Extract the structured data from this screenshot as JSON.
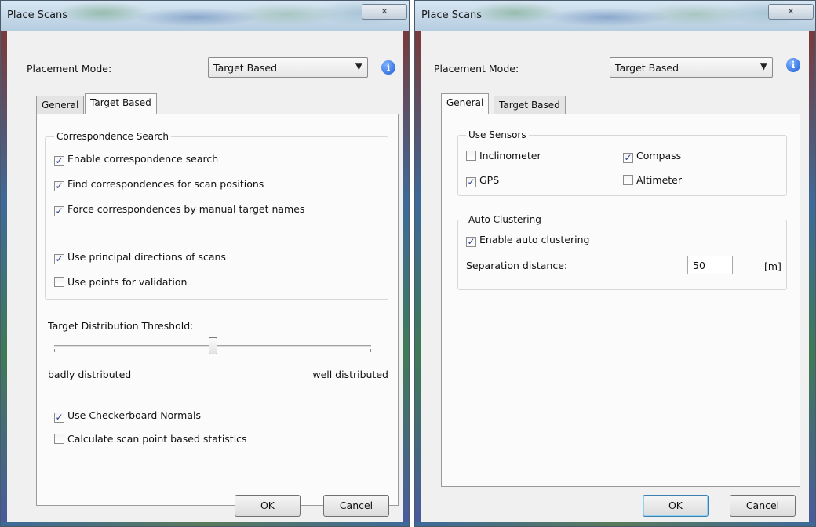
{
  "left": {
    "title": "Place Scans",
    "close_glyph": "✕",
    "placement_label": "Placement Mode:",
    "placement_value": "Target Based",
    "tabs": [
      {
        "label": "General"
      },
      {
        "label": "Target Based"
      }
    ],
    "active_tab": "Target Based",
    "corr_group": "Correspondence Search",
    "checks": [
      {
        "label": "Enable correspondence search",
        "checked": true
      },
      {
        "label": "Find correspondences for scan positions",
        "checked": true
      },
      {
        "label": "Force correspondences by manual target names",
        "checked": true
      },
      {
        "label": "Use principal directions of scans",
        "checked": true
      },
      {
        "label": "Use points for validation",
        "checked": false
      }
    ],
    "threshold_label": "Target Distribution Threshold:",
    "slider_value": 0.5,
    "slider_min_label": "badly distributed",
    "slider_max_label": "well distributed",
    "bottom_checks": [
      {
        "label": "Use Checkerboard Normals",
        "checked": true
      },
      {
        "label": "Calculate scan point based statistics",
        "checked": false
      }
    ],
    "ok": "OK",
    "cancel": "Cancel"
  },
  "right": {
    "title": "Place Scans",
    "close_glyph": "✕",
    "placement_label": "Placement Mode:",
    "placement_value": "Target Based",
    "tabs": [
      {
        "label": "General"
      },
      {
        "label": "Target Based"
      }
    ],
    "active_tab": "General",
    "sensors_group": "Use Sensors",
    "sensors": [
      {
        "label": "Inclinometer",
        "checked": false
      },
      {
        "label": "Compass",
        "checked": true
      },
      {
        "label": "GPS",
        "checked": true
      },
      {
        "label": "Altimeter",
        "checked": false
      }
    ],
    "cluster_group": "Auto Clustering",
    "cluster_enable": {
      "label": "Enable auto clustering",
      "checked": true
    },
    "separation_label": "Separation distance:",
    "separation_value": "50",
    "separation_unit": "[m]",
    "ok": "OK",
    "cancel": "Cancel"
  },
  "icons": {
    "info": "info-icon",
    "dropdown": "chevron-down-icon",
    "close": "close-icon",
    "check": "checkmark-icon"
  }
}
